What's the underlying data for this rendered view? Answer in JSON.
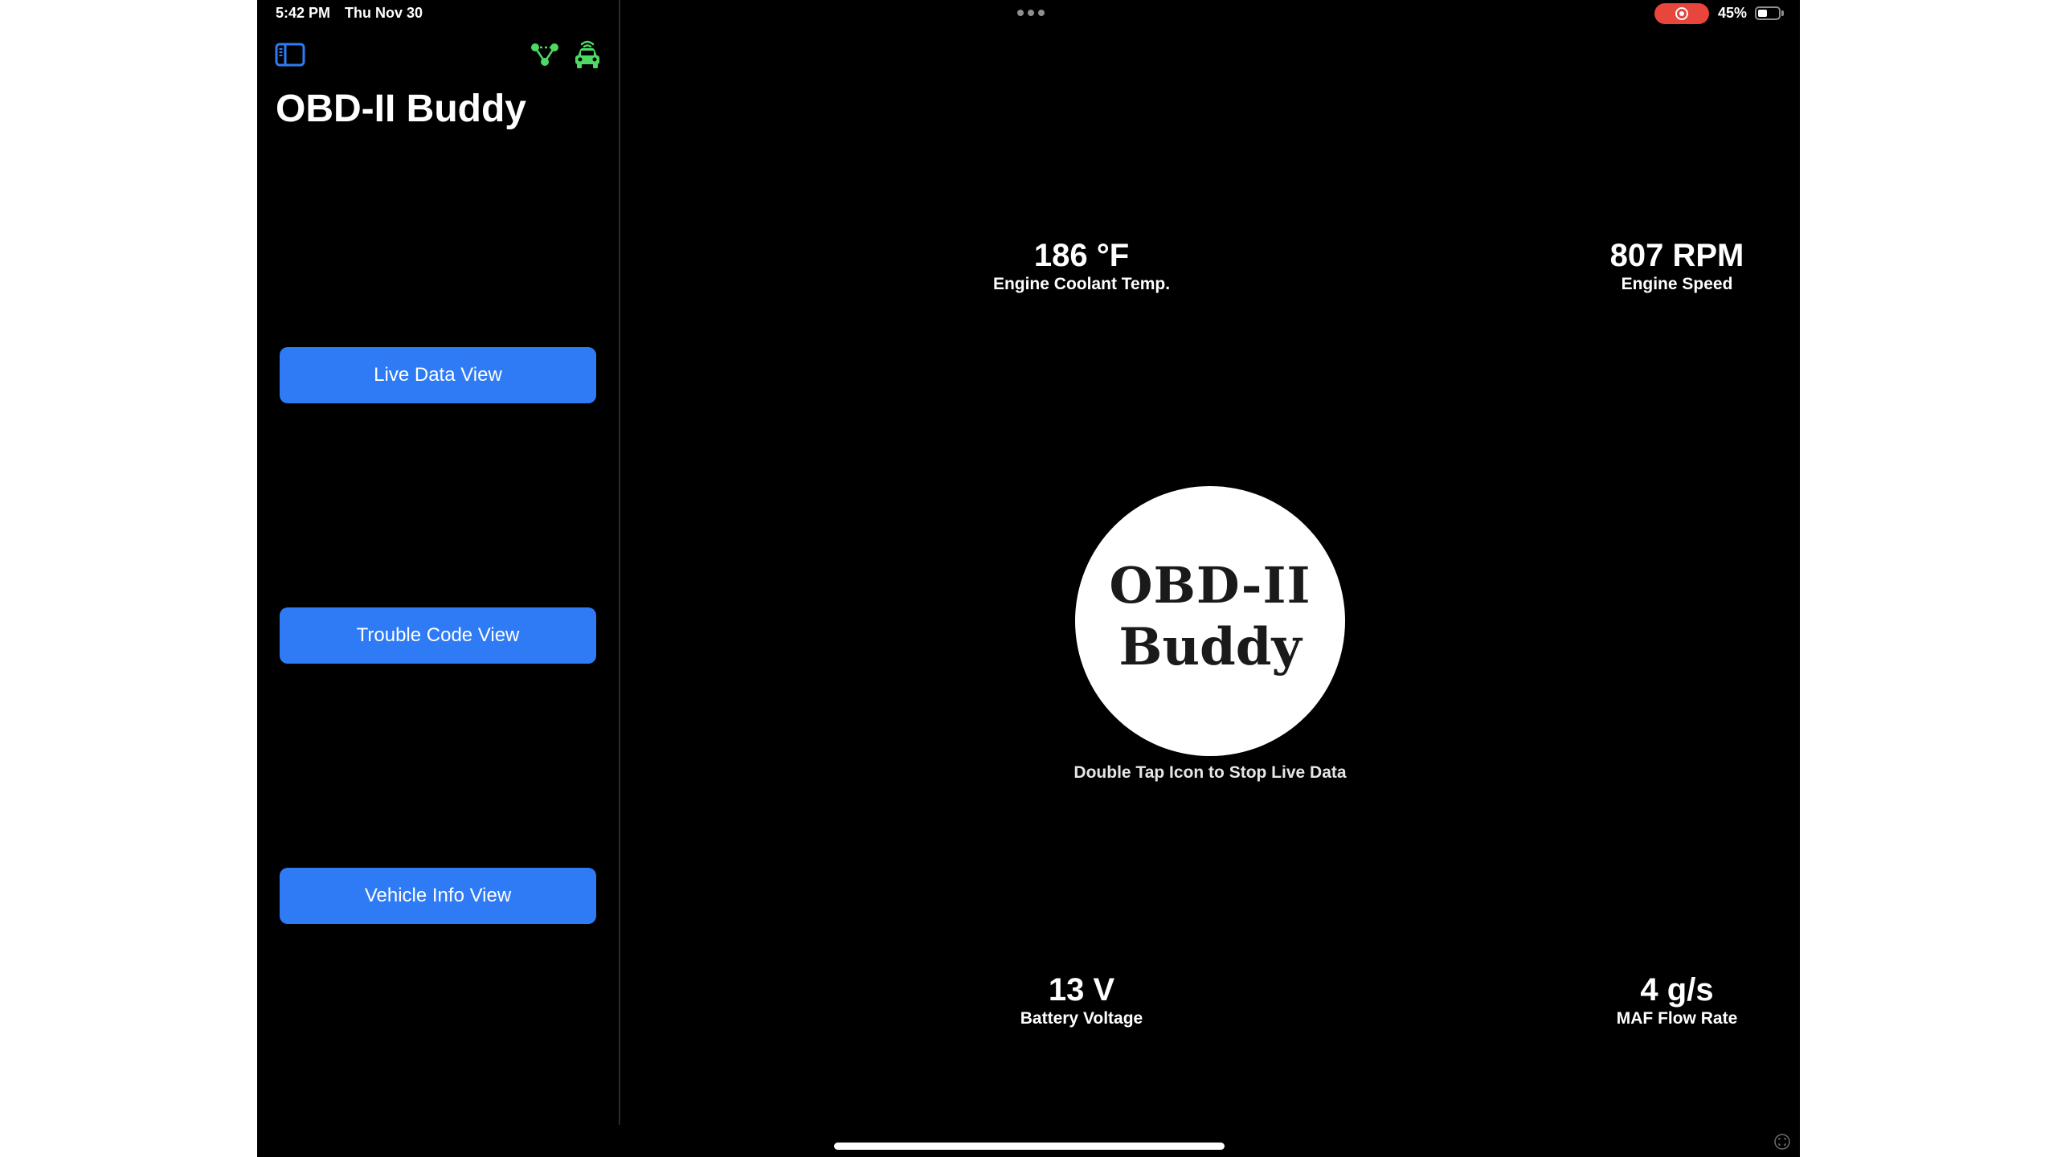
{
  "status_bar": {
    "time": "5:42 PM",
    "date": "Thu Nov 30",
    "battery_percent_text": "45%",
    "battery_level": 0.45,
    "recording_active": true,
    "multitasking_icon": "ellipsis-icon"
  },
  "sidebar": {
    "title": "OBD-II Buddy",
    "toggle_icon": "sidebar-toggle-icon",
    "connection_icons": [
      "network-icon",
      "car-connected-icon"
    ],
    "buttons": [
      {
        "label": "Live Data View"
      },
      {
        "label": "Trouble Code View"
      },
      {
        "label": "Vehicle Info View"
      }
    ]
  },
  "main": {
    "metrics": {
      "coolant": {
        "value": "186 °F",
        "label": "Engine Coolant Temp."
      },
      "rpm": {
        "value": "807 RPM",
        "label": "Engine Speed"
      },
      "voltage": {
        "value": "13 V",
        "label": "Battery Voltage"
      },
      "maf": {
        "value": "4 g/s",
        "label": "MAF Flow Rate"
      }
    },
    "logo": {
      "line1": "OBD-II",
      "line2": "Buddy"
    },
    "logo_hint": "Double Tap Icon to Stop Live Data"
  },
  "colors": {
    "background": "#000000",
    "accent_button": "#2f7bf5",
    "icon_green": "#4cd964",
    "icon_blue": "#2f7bf5",
    "recording_red": "#e8453c"
  }
}
